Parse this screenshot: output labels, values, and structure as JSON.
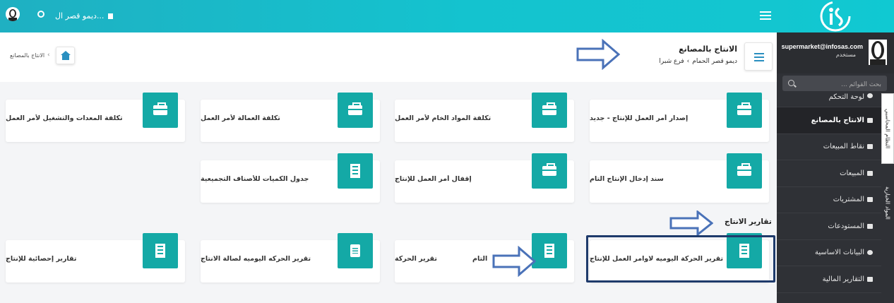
{
  "topbar": {
    "branch_label": "ديمو قصر ال..."
  },
  "sidebar": {
    "email": "supermarket@infosas.com",
    "role": "مستخدم",
    "search_placeholder": "بحث القوائم ...",
    "items": [
      {
        "label": "لوحة التحكم"
      },
      {
        "label": "الانتاج بالمصانع",
        "active": true
      },
      {
        "label": "نقاط المبيعات"
      },
      {
        "label": "المبيعات"
      },
      {
        "label": "المشتريات"
      },
      {
        "label": "المستودعات"
      },
      {
        "label": "البيانات الاساسية"
      },
      {
        "label": "التقارير المالية"
      }
    ],
    "vertical_tabs": [
      "النظام المحاسبي",
      "المواد الخبازية"
    ]
  },
  "header": {
    "title": "الانتاج بالمصانع",
    "crumb_branch": "ديمو قصر الحمام",
    "crumb_sep": "›",
    "crumb_sub": "فرع شبرا",
    "breadcrumb_text": "الانتاج بالمصانع"
  },
  "cards_row1": [
    {
      "label": "إصدار أمر العمل للإنتاج - جديد",
      "icon": "briefcase-icon"
    },
    {
      "label": "تكلفة المواد الخام لأمر العمل",
      "icon": "briefcase-icon"
    },
    {
      "label": "تكلفة العمالة لأمر العمل",
      "icon": "briefcase-icon"
    },
    {
      "label": "تكلفة المعدات والتشغيل لأمر العمل",
      "icon": "briefcase-icon"
    }
  ],
  "cards_row2": [
    {
      "label": "سند إدخال الإنتاج التام",
      "icon": "briefcase-icon"
    },
    {
      "label": "إقفال أمر العمل للإنتاج",
      "icon": "briefcase-icon"
    },
    {
      "label": "جدول الكميات للأصناف التجميعية",
      "icon": "building-icon"
    }
  ],
  "reports_title": "تقارير الانتاج",
  "cards_row3": [
    {
      "label": "تقرير الحركة اليوميه لاوامر العمل للإنتاج",
      "icon": "building-icon"
    },
    {
      "label": "تقرير الحركة",
      "label2": "التام",
      "icon": "building-icon"
    },
    {
      "label": "تقرير الحركه اليوميه لصالة الانتاج",
      "icon": "document-icon"
    },
    {
      "label": "تقارير إحصائية للإنتاج",
      "icon": "building-icon"
    }
  ],
  "colors": {
    "accent": "#14a9a6",
    "topbar": "#14c3cf",
    "sidebar": "#2f3136",
    "annotation": "#4a72b8"
  }
}
